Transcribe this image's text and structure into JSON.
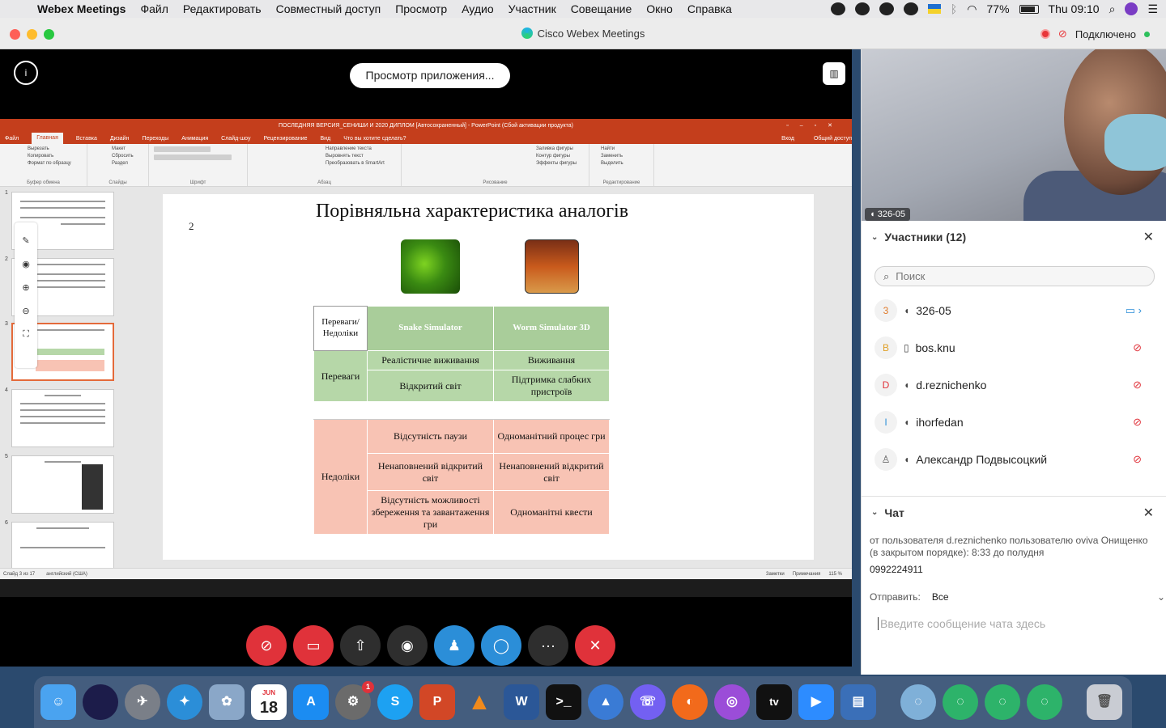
{
  "menubar": {
    "app_name": "Webex Meetings",
    "items": [
      "Файл",
      "Редактировать",
      "Совместный доступ",
      "Просмотр",
      "Аудио",
      "Участник",
      "Совещание",
      "Окно",
      "Справка"
    ],
    "battery": "77%",
    "clock": "Thu 09:10"
  },
  "window": {
    "title": "Cisco Webex Meetings",
    "status": "Подключено"
  },
  "stage": {
    "app_view_button": "Просмотр приложения..."
  },
  "ppt": {
    "title": "ПОСЛЕДНЯЯ ВЕРСИЯ_СЕНИШИ И 2020 ДИПЛОМ [Автосохраненный] - PowerPoint (Сбой активации продукта)",
    "tabs": [
      "Файл",
      "Главная",
      "Вставка",
      "Дизайн",
      "Переходы",
      "Анимация",
      "Слайд-шоу",
      "Рецензирование",
      "Вид",
      "Что вы хотите сделать?"
    ],
    "tabs_right": [
      "Вход",
      "Общий доступ"
    ],
    "ribbon_groups": [
      "Буфер обмена",
      "Слайды",
      "Шрифт",
      "Абзац",
      "Рисование",
      "Редактирование"
    ],
    "ribbon_items": {
      "clipboard": [
        "Вырезать",
        "Копировать",
        "Формат по образцу"
      ],
      "slides": [
        "Макет",
        "Сбросить",
        "Раздел"
      ],
      "paragraph": [
        "Направление текста",
        "Выровнять текст",
        "Преобразовать в SmartArt"
      ],
      "drawing": [
        "Заливка фигуры",
        "Контур фигуры",
        "Эффекты фигуры"
      ],
      "editing": [
        "Найти",
        "Заменить",
        "Выделить"
      ]
    },
    "thumb_numbers": [
      "1",
      "2",
      "3",
      "4",
      "5",
      "6"
    ],
    "status_left": "Слайд 3 из 17",
    "status_lang": "английский (США)",
    "status_right": [
      "Заметки",
      "Примечания",
      "115 %"
    ]
  },
  "slide": {
    "title": "Порівняльна характеристика аналогів",
    "number": "2",
    "table": {
      "corner": "Переваги/ Недоліки",
      "col1": "Snake Simulator",
      "col2": "Worm Simulator 3D",
      "adv_label": "Переваги",
      "adv": [
        [
          "Реалістичне виживання",
          "Виживання"
        ],
        [
          "Відкритий світ",
          "Підтримка слабких пристроїв"
        ]
      ],
      "dis_label": "Недоліки",
      "dis": [
        [
          "Відсутність паузи",
          "Одноманітний процес гри"
        ],
        [
          "Ненаповнений відкритий світ",
          "Ненаповнений відкритий світ"
        ],
        [
          "Відсутність можливості збереження та завантаження гри",
          "Одноманітні квести"
        ]
      ]
    }
  },
  "video": {
    "label": "326-05"
  },
  "participants": {
    "header": "Участники (12)",
    "search_placeholder": "Поиск",
    "list": [
      {
        "avatar": "3",
        "name": "326-05"
      },
      {
        "avatar": "B",
        "name": "bos.knu"
      },
      {
        "avatar": "D",
        "name": "d.reznichenko"
      },
      {
        "avatar": "I",
        "name": "ihorfedan"
      },
      {
        "avatar": "",
        "name": "Александр Подвысоцкий"
      }
    ]
  },
  "chat": {
    "header": "Чат",
    "message_meta": "от пользователя d.reznichenko пользователю oviva Онищенко (в закрытом порядке):   8:33  до полудня",
    "message_body": "0992224911",
    "send_to_label": "Отправить:",
    "send_to_value": "Все",
    "input_placeholder": "Введите сообщение чата здесь"
  },
  "dock": {
    "calendar_month": "JUN",
    "calendar_day": "18",
    "prefs_badge": "1"
  },
  "colors": {
    "ppt_accent": "#c43e1c",
    "end_call": "#e0323a",
    "webex_blue": "#2b8ed8",
    "table_green": "#b6d7a8",
    "table_pink": "#f8c3b4"
  }
}
